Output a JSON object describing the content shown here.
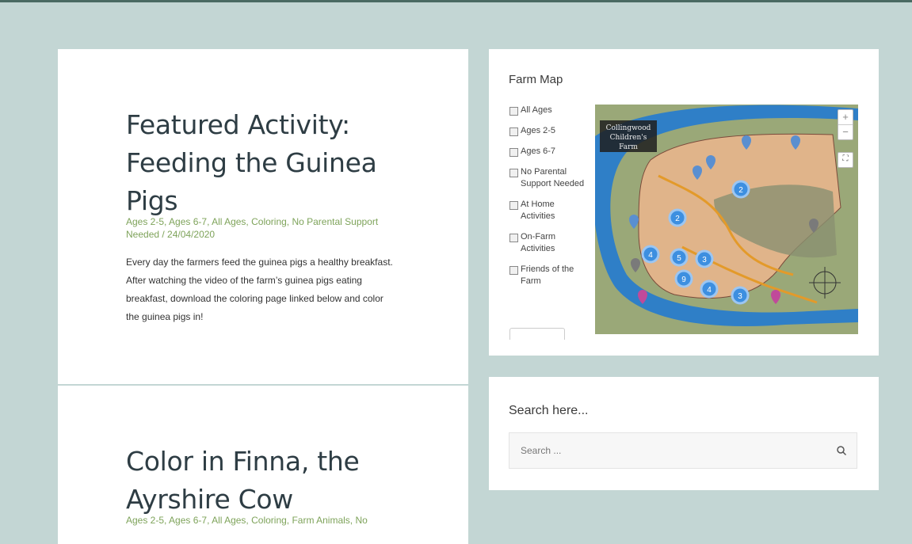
{
  "posts": [
    {
      "title": "Featured Activity: Feeding the Guinea Pigs",
      "meta": "Ages 2-5, Ages 6-7, All Ages, Coloring, No Parental Support Needed / 24/04/2020",
      "excerpt": "Every day the farmers feed the guinea pigs a healthy breakfast. After watching the video of the farm’s guinea pigs eating breakfast, download the coloring page linked below and color the guinea pigs in!"
    },
    {
      "title": "Color in Finna, the Ayrshire Cow",
      "meta": "Ages 2-5, Ages 6-7, All Ages, Coloring, Farm Animals, No"
    }
  ],
  "map_widget": {
    "title": "Farm Map",
    "filters": [
      "All Ages",
      "Ages 2-5",
      "Ages 6-7",
      "No Parental Support Needed",
      "At Home Activities",
      "On-Farm Activities",
      "Friends of the Farm"
    ],
    "map_banner": [
      "Collingwood",
      "Children's",
      "Farm"
    ],
    "zoom_in": "+",
    "zoom_out": "−",
    "fullscreen_icon": "⛶",
    "cluster_counts": [
      "2",
      "2",
      "4",
      "5",
      "3",
      "9",
      "4",
      "3"
    ],
    "colors": {
      "cluster": "#3d8fe0",
      "marker": "#5a8fd0",
      "marker_grey": "#7a7a7a",
      "marker_pink": "#c04a9a",
      "river": "#2f7fc7",
      "land": "#e8b98a",
      "grass": "#a8b37a"
    }
  },
  "search_widget": {
    "title": "Search here...",
    "placeholder": "Search ..."
  }
}
